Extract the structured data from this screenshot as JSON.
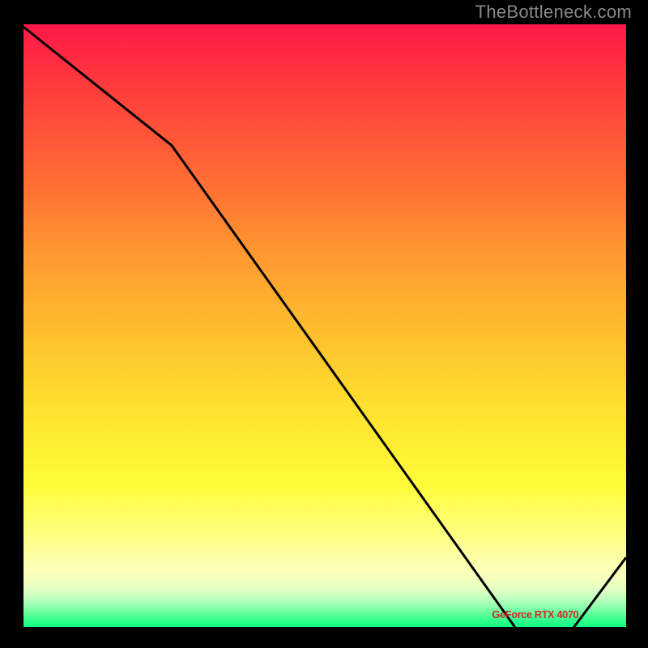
{
  "watermark": "TheBottleneck.com",
  "legend_label": "GeForce RTX 4070",
  "colors": {
    "gradient_top": "#ff1848",
    "gradient_bottom": "#00ff7e",
    "line": "#000000",
    "legend_text": "#cc2b2b"
  },
  "chart_data": {
    "type": "line",
    "title": "",
    "xlabel": "",
    "ylabel": "",
    "xlim": [
      0,
      100
    ],
    "ylim": [
      0,
      100
    ],
    "x": [
      0,
      25,
      82,
      91,
      100
    ],
    "values": [
      100,
      80,
      0,
      0,
      12
    ],
    "annotations": [
      {
        "text": "GeForce RTX 4070",
        "x": 85,
        "y": 2
      }
    ]
  }
}
